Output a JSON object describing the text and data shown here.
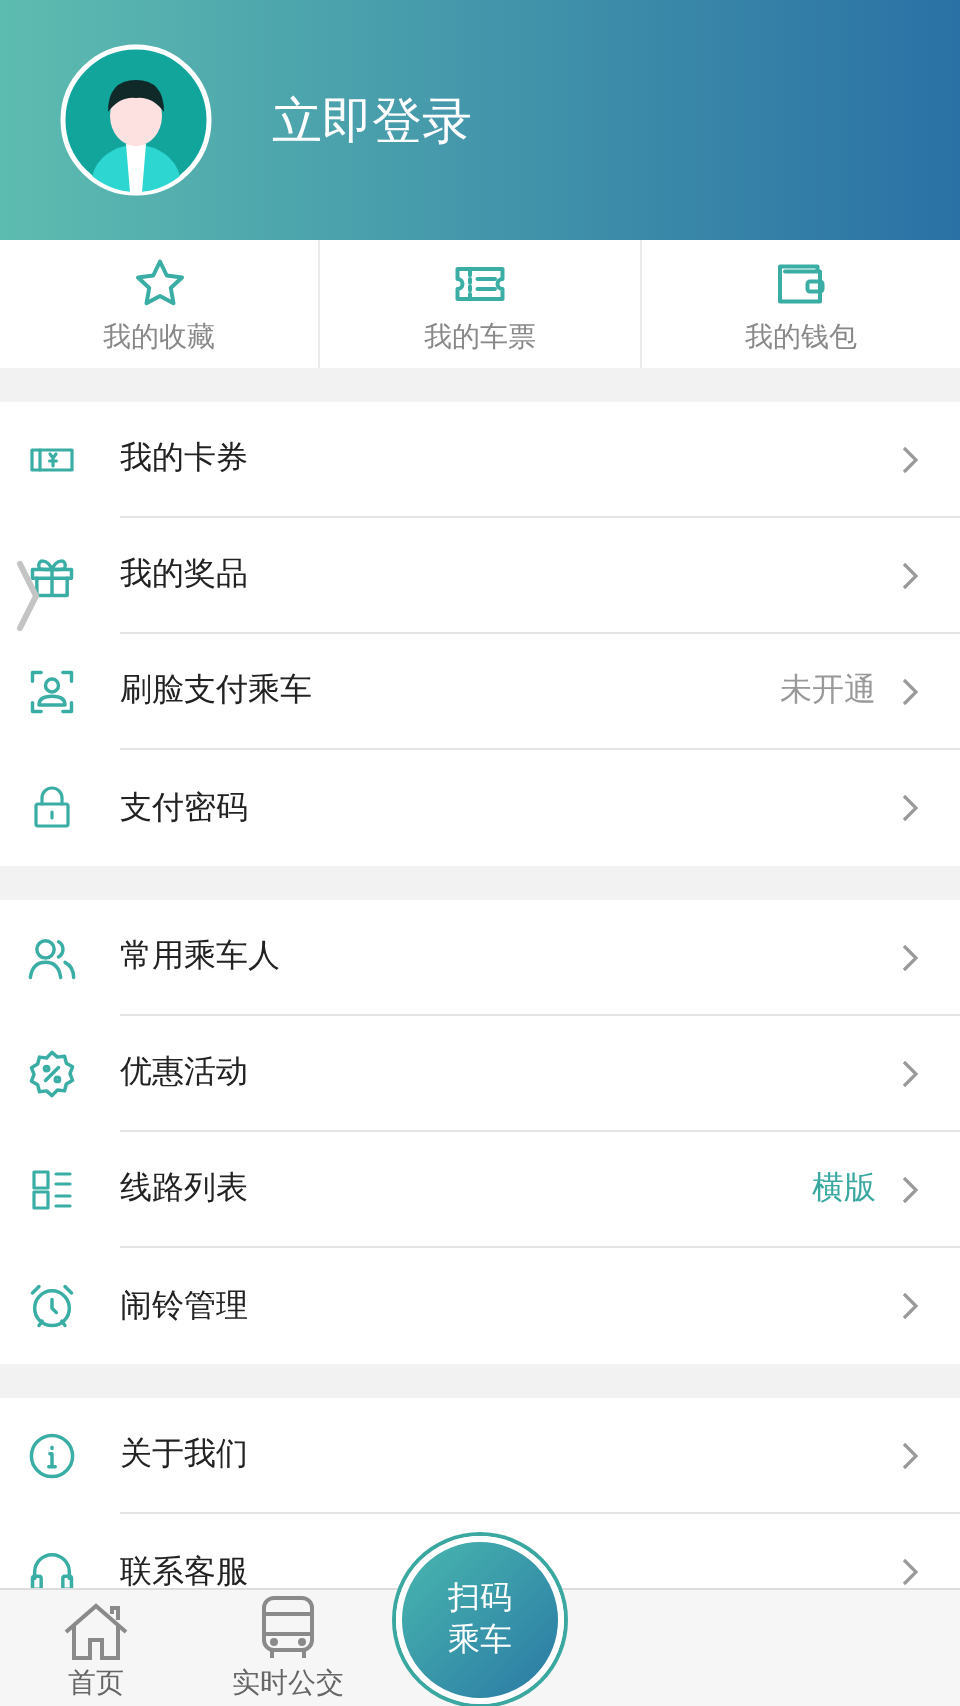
{
  "header": {
    "login": "立即登录"
  },
  "shortcuts": [
    {
      "label": "我的收藏"
    },
    {
      "label": "我的车票"
    },
    {
      "label": "我的钱包"
    }
  ],
  "groups": [
    {
      "items": [
        {
          "label": "我的卡券",
          "kind": "plain"
        },
        {
          "label": "我的奖品",
          "kind": "plain"
        },
        {
          "label": "刷脸支付乘车",
          "kind": "status",
          "value": "未开通"
        },
        {
          "label": "支付密码",
          "kind": "plain"
        }
      ]
    },
    {
      "items": [
        {
          "label": "常用乘车人",
          "kind": "plain"
        },
        {
          "label": "优惠活动",
          "kind": "plain"
        },
        {
          "label": "线路列表",
          "kind": "option",
          "value": "横版"
        },
        {
          "label": "闹铃管理",
          "kind": "plain"
        }
      ]
    },
    {
      "items": [
        {
          "label": "关于我们",
          "kind": "plain"
        },
        {
          "label": "联系客服",
          "kind": "plain"
        }
      ]
    }
  ],
  "tab_bar": {
    "tabs": [
      {
        "label": "首页"
      },
      {
        "label": "实时公交"
      }
    ],
    "scan_button": {
      "line_1": "扫码",
      "line_2": "乘车"
    }
  }
}
